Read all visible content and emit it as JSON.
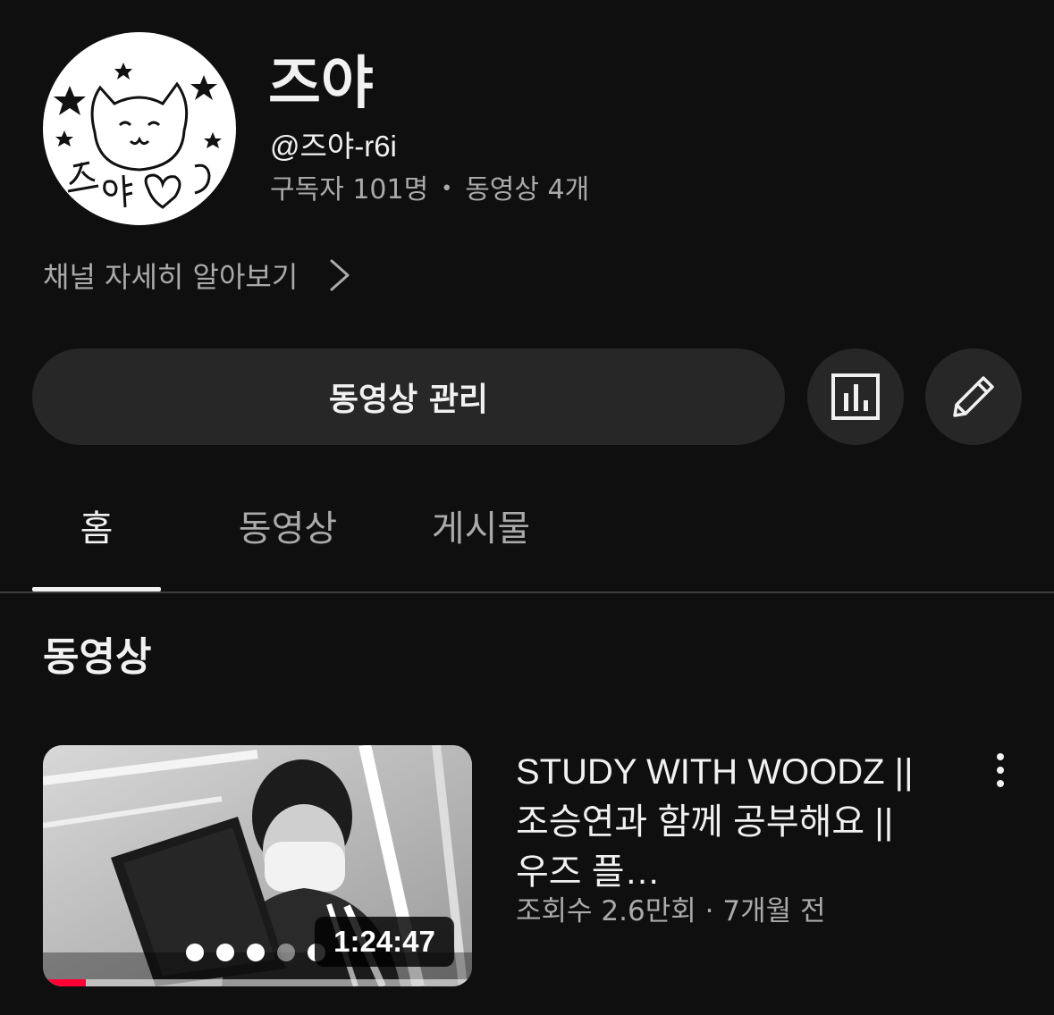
{
  "channel": {
    "name": "즈야",
    "handle": "@즈야-r6i",
    "subscribers": "구독자 101명",
    "videos_count": "동영상 4개",
    "separator": "•",
    "about_label": "채널 자세히 알아보기",
    "avatar_text": "즈야"
  },
  "actions": {
    "manage_videos_label": "동영상 관리",
    "stats_icon": "bar-chart-icon",
    "edit_icon": "pencil-icon"
  },
  "tabs": [
    {
      "label": "홈",
      "active": true
    },
    {
      "label": "동영상",
      "active": false
    },
    {
      "label": "게시물",
      "active": false
    }
  ],
  "section": {
    "title": "동영상"
  },
  "videos": [
    {
      "title": "STUDY WITH WOODZ || 조승연과 함께 공부해요 || 우즈 플…",
      "views": "조회수 2.6만회",
      "age": "7개월 전",
      "meta_separator": "·",
      "duration": "1:24:47",
      "watched_fraction": 0.1,
      "menu_icon": "more-vertical-icon"
    }
  ],
  "colors": {
    "background": "#0f0f0f",
    "button_bg": "#272727",
    "text_primary": "#f1f1f1",
    "text_secondary": "#aaaaaa",
    "progress_red": "#ff0033"
  }
}
